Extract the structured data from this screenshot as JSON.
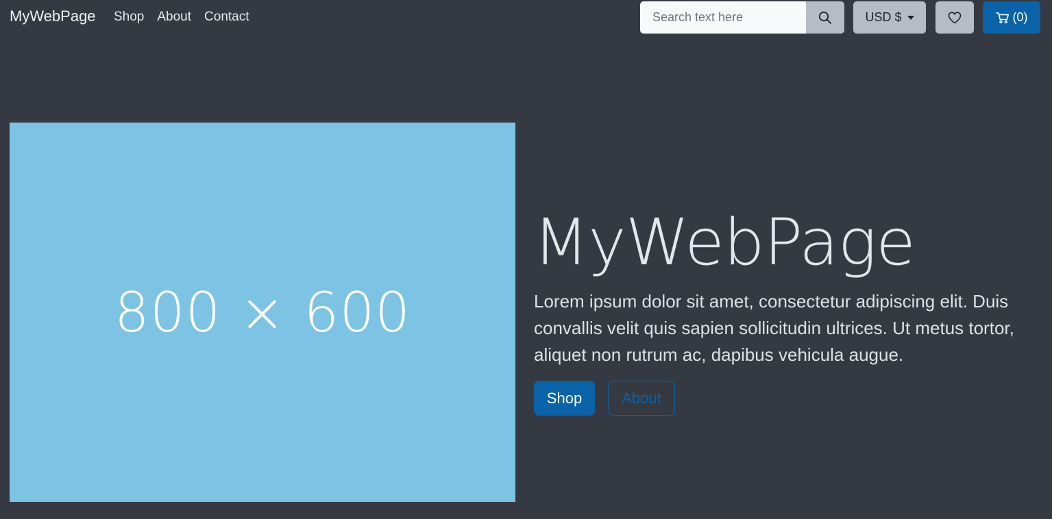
{
  "navbar": {
    "brand": "MyWebPage",
    "links": [
      "Shop",
      "About",
      "Contact"
    ],
    "search": {
      "placeholder": "Search text here"
    },
    "currency": "USD $",
    "cart_label": "(0)"
  },
  "hero": {
    "image_text": "800 × 600",
    "title": "MyWebPage",
    "text": "Lorem ipsum dolor sit amet, consectetur adipiscing elit. Duis convallis velit quis sapien sollicitudin ultrices. Ut metus tortor, aliquet non rutrum ac, dapibus vehicula augue.",
    "primary_button": "Shop",
    "secondary_button": "About"
  },
  "icons": {
    "search": "search-icon",
    "currency_caret": "chevron-down-icon",
    "wishlist": "heart-icon",
    "cart": "cart-icon"
  },
  "colors": {
    "background": "#353a42",
    "accent": "#0a62a8",
    "placeholder": "#7cc3e4",
    "secondary_button": "#b6bcc4"
  }
}
